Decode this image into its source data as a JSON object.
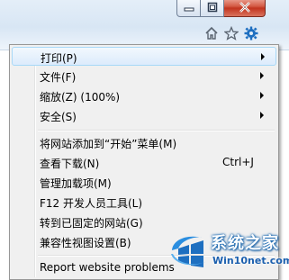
{
  "window": {
    "minimize_icon": "minimize-icon",
    "maximize_icon": "restore-icon",
    "close_icon": "close-icon"
  },
  "toolbar": {
    "icons": [
      "home-icon",
      "favorites-star-icon",
      "tools-gear-icon"
    ],
    "accent": "#1e6fc0"
  },
  "menu": {
    "highlight_color": "#dcebfc",
    "items": [
      {
        "label": "打印(P)",
        "submenu": true
      },
      {
        "label": "文件(F)",
        "submenu": true
      },
      {
        "label": "缩放(Z) (100%)",
        "submenu": true
      },
      {
        "label": "安全(S)",
        "submenu": true
      },
      {
        "label": "将网站添加到“开始”菜单(M)",
        "submenu": false
      },
      {
        "label": "查看下载(N)",
        "shortcut": "Ctrl+J",
        "submenu": false
      },
      {
        "label": "管理加载项(M)",
        "submenu": false
      },
      {
        "label": "F12 开发人员工具(L)",
        "submenu": false
      },
      {
        "label": "转到已固定的网站(G)",
        "submenu": false
      },
      {
        "label": "兼容性视图设置(B)",
        "submenu": false
      },
      {
        "label": "Report website problems",
        "submenu": false
      }
    ]
  },
  "watermark": {
    "title": "系统之家",
    "url": "Win10net.com"
  }
}
